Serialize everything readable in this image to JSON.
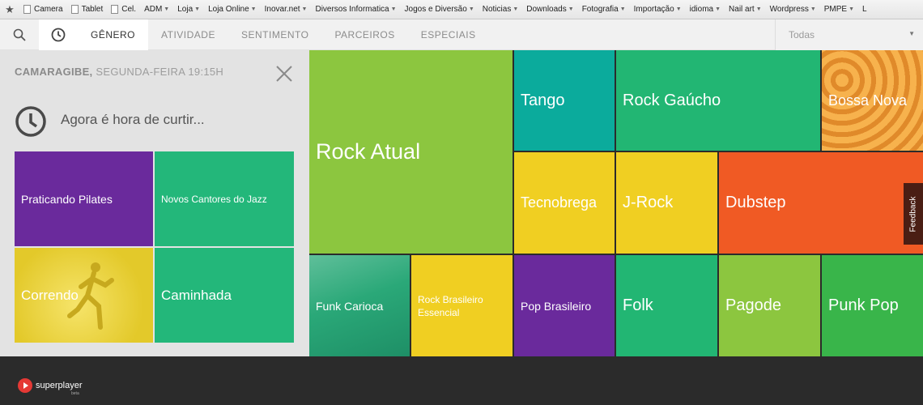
{
  "bookmarks": {
    "items": [
      {
        "label": "Camera",
        "icon": "page-icon",
        "dropdown": false
      },
      {
        "label": "Tablet",
        "icon": "page-icon",
        "dropdown": false
      },
      {
        "label": "Cel.",
        "icon": "page-icon",
        "dropdown": false
      },
      {
        "label": "ADM",
        "dropdown": true
      },
      {
        "label": "Loja",
        "dropdown": true
      },
      {
        "label": "Loja Online",
        "dropdown": true
      },
      {
        "label": "Inovar.net",
        "dropdown": true
      },
      {
        "label": "Diversos Informatica",
        "dropdown": true
      },
      {
        "label": "Jogos e Diversão",
        "dropdown": true
      },
      {
        "label": "Noticias",
        "dropdown": true
      },
      {
        "label": "Downloads",
        "dropdown": true
      },
      {
        "label": "Fotografia",
        "dropdown": true
      },
      {
        "label": "Importação",
        "dropdown": true
      },
      {
        "label": "idioma",
        "dropdown": true
      },
      {
        "label": "Nail art",
        "dropdown": true
      },
      {
        "label": "Wordpress",
        "dropdown": true
      },
      {
        "label": "PMPE",
        "dropdown": true
      },
      {
        "label": "L",
        "dropdown": false
      }
    ]
  },
  "nav": {
    "tabs": [
      "GÊNERO",
      "ATIVIDADE",
      "SENTIMENTO",
      "PARCEIROS",
      "ESPECIAIS"
    ],
    "active_tab": 0,
    "filter_value": "Todas"
  },
  "panel": {
    "location": "CAMARAGIBE,",
    "datetime": "SEGUNDA-FEIRA 19:15H",
    "message": "Agora é hora de curtir...",
    "tiles": [
      {
        "label": "Praticando Pilates",
        "color": "#6a2a9c"
      },
      {
        "label": "Novos Cantores do Jazz",
        "color": "#23b77a"
      },
      {
        "label": "Correndo",
        "color": "#e3c92a"
      },
      {
        "label": "Caminhada",
        "color": "#23b77a"
      }
    ]
  },
  "genres": [
    {
      "label": "Rock Atual",
      "color": "#8cc63f"
    },
    {
      "label": "Tango",
      "color": "#0bab9c"
    },
    {
      "label": "Rock Gaúcho",
      "color": "#22b673"
    },
    {
      "label": "Bossa Nova",
      "color": "#f4a23a"
    },
    {
      "label": "Tecnobrega",
      "color": "#f0cf22"
    },
    {
      "label": "J-Rock",
      "color": "#f0cf22"
    },
    {
      "label": "Dubstep",
      "color": "#f05a24"
    },
    {
      "label": "Funk Carioca",
      "color": "#2aa878"
    },
    {
      "label": "Rock Brasileiro Essencial",
      "color": "#f0cf22"
    },
    {
      "label": "Pop Brasileiro",
      "color": "#6a2a9c"
    },
    {
      "label": "Folk",
      "color": "#22b673"
    },
    {
      "label": "Pagode",
      "color": "#8cc63f"
    },
    {
      "label": "Punk Pop",
      "color": "#39b54a"
    }
  ],
  "feedback_label": "Feedback",
  "footer": {
    "brand": "superplayer",
    "tagline": "beta"
  }
}
